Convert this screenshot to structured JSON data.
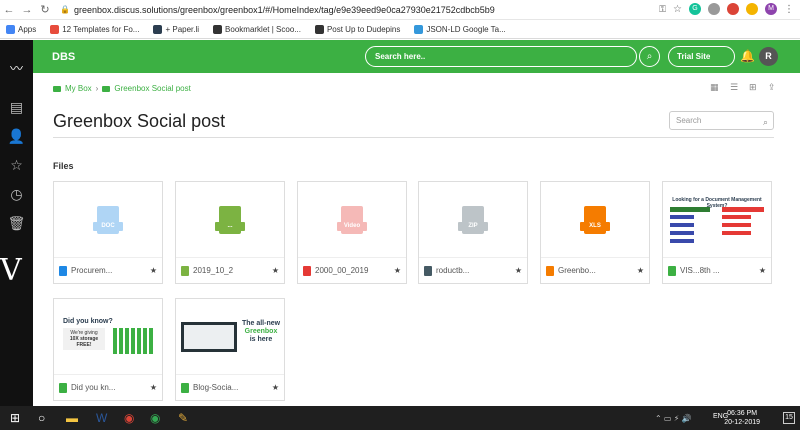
{
  "browser": {
    "url": "greenbox.discus.solutions/greenbox/greenbox1/#/HomeIndex/tag/e9e39eed9e0ca27930e21752cdbcb5b9",
    "bookmarks": [
      {
        "label": "Apps",
        "color": "#4285f4"
      },
      {
        "label": "12 Templates for Fo...",
        "color": "#e74c3c"
      },
      {
        "label": "+ Paper.li",
        "color": "#2c3e50"
      },
      {
        "label": "Bookmarklet | Scoo...",
        "color": "#333333"
      },
      {
        "label": "Post Up to Dudepins",
        "color": "#333333"
      },
      {
        "label": "JSON-LD Google Ta...",
        "color": "#3498db"
      }
    ],
    "profile_initial": "M"
  },
  "header": {
    "brand": "DBS",
    "search_placeholder": "Search here..",
    "trial_label": "Trial Site",
    "avatar_initial": "R"
  },
  "breadcrumb": {
    "root": "My Box",
    "current": "Greenbox Social post"
  },
  "page": {
    "title": "Greenbox Social post",
    "search_placeholder": "Search",
    "section": "Files"
  },
  "files": [
    {
      "name": "Procurem...",
      "type": "DOC",
      "color": "#1e88e5"
    },
    {
      "name": "2019_10_2",
      "type": "...",
      "color": "#7cb342"
    },
    {
      "name": "2000_00_2019",
      "type": "Video",
      "color": "#e53935"
    },
    {
      "name": "roductb...",
      "type": "ZIP",
      "color": "#455a64"
    },
    {
      "name": "Greenbo...",
      "type": "XLS",
      "color": "#f57c00"
    },
    {
      "name": "VIS...8th ...",
      "type": "image",
      "color": "#3cb043"
    },
    {
      "name": "Did you kn...",
      "type": "image",
      "color": "#3cb043"
    },
    {
      "name": "Blog-Socia...",
      "type": "image",
      "color": "#3cb043"
    }
  ],
  "poster1": {
    "title": "Looking for a Document Management System?"
  },
  "poster2": {
    "q": "Did you know?",
    "line1": "We're giving",
    "line2": "10X storage",
    "line3": "FREE!"
  },
  "poster3": {
    "line1": "The all-new",
    "line2": "Greenbox",
    "line3": "is here"
  },
  "taskbar": {
    "time": "06:36 PM",
    "date": "20-12-2019",
    "lang": "ENG",
    "notifications": "15"
  }
}
